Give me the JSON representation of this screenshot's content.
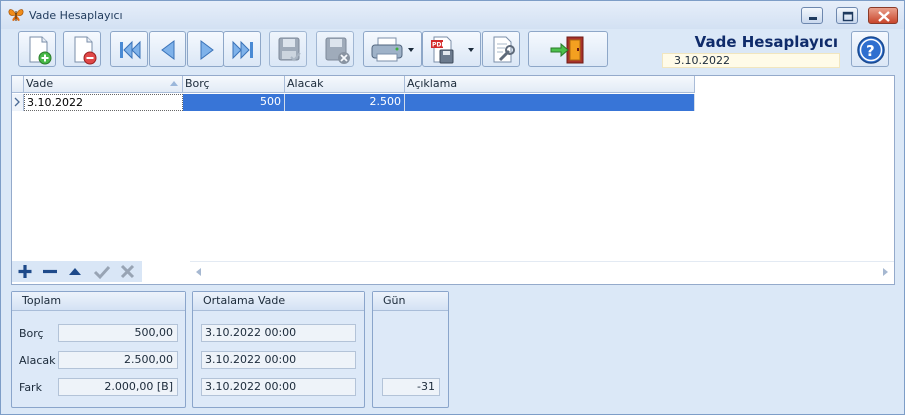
{
  "window": {
    "title": "Vade Hesaplayıcı"
  },
  "header": {
    "title": "Vade Hesaplayıcı",
    "date": "3.10.2022"
  },
  "toolbar": {
    "buttons": [
      {
        "name": "new-record-button",
        "icon": "new-document-icon",
        "enabled": true
      },
      {
        "name": "delete-record-button",
        "icon": "delete-document-icon",
        "enabled": true
      },
      {
        "name": "first-record-button",
        "icon": "first-icon",
        "enabled": true
      },
      {
        "name": "previous-record-button",
        "icon": "previous-icon",
        "enabled": true
      },
      {
        "name": "next-record-button",
        "icon": "next-icon",
        "enabled": true
      },
      {
        "name": "last-record-button",
        "icon": "last-icon",
        "enabled": true
      },
      {
        "name": "save-button",
        "icon": "save-icon",
        "enabled": false
      },
      {
        "name": "cancel-save-button",
        "icon": "save-cancel-icon",
        "enabled": false
      },
      {
        "name": "print-button",
        "icon": "printer-icon",
        "enabled": true
      },
      {
        "name": "export-pdf-button",
        "icon": "pdf-export-icon",
        "enabled": true
      },
      {
        "name": "settings-button",
        "icon": "wrench-icon",
        "enabled": true
      },
      {
        "name": "exit-button",
        "icon": "exit-door-icon",
        "enabled": true
      },
      {
        "name": "help-button",
        "icon": "help-icon",
        "enabled": true
      }
    ]
  },
  "grid": {
    "columns": [
      "Vade",
      "Borç",
      "Alacak",
      "Açıklama"
    ],
    "rows": [
      {
        "vade": "3.10.2022",
        "borc": "500",
        "alacak": "2.500",
        "aciklama": ""
      }
    ],
    "navigator_icons": [
      "plus-icon",
      "minus-icon",
      "up-arrow-icon",
      "check-icon",
      "cross-icon"
    ]
  },
  "toplam": {
    "title": "Toplam",
    "borc_label": "Borç",
    "borc_value": "500,00",
    "alacak_label": "Alacak",
    "alacak_value": "2.500,00",
    "fark_label": "Fark",
    "fark_value": "2.000,00 [B]"
  },
  "ortalama_vade": {
    "title": "Ortalama Vade",
    "borc_value": "3.10.2022 00:00",
    "alacak_value": "3.10.2022 00:00",
    "fark_value": "3.10.2022 00:00"
  },
  "gun": {
    "title": "Gün",
    "value": "-31"
  },
  "colors": {
    "selection": "#3875d7",
    "title_accent": "#0f2b6a",
    "panel_bg": "#dde9f8"
  }
}
